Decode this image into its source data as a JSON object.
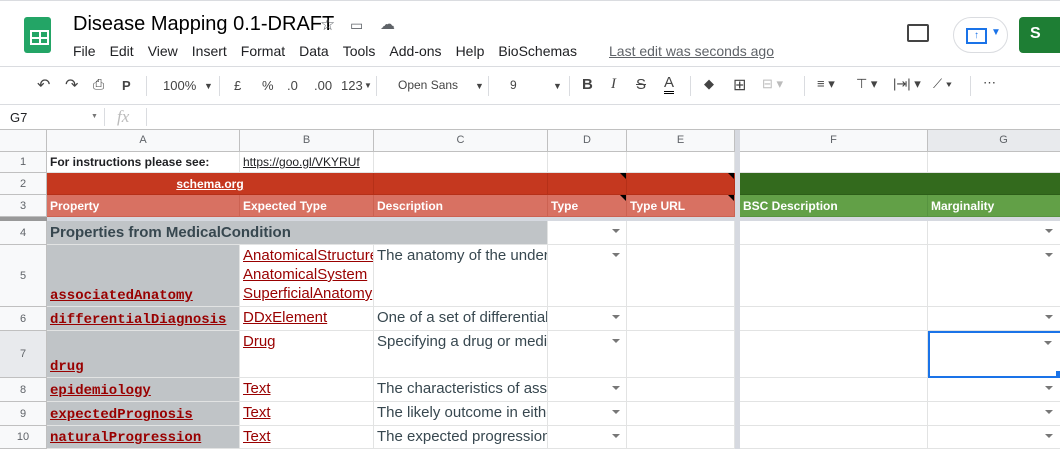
{
  "app": {
    "title": "Disease Mapping 0.1-DRAFT",
    "menu": [
      "File",
      "Edit",
      "View",
      "Insert",
      "Format",
      "Data",
      "Tools",
      "Add-ons",
      "Help",
      "BioSchemas"
    ],
    "last_edit": "Last edit was seconds ago",
    "share_label": "S"
  },
  "toolbar": {
    "zoom": "100%",
    "currency": "£",
    "percent": "%",
    "dec_less": ".0",
    "dec_more": ".00",
    "format": "123",
    "font": "Open Sans",
    "font_size": "9"
  },
  "formula": {
    "cell_ref": "G7",
    "fx": "fx",
    "value": ""
  },
  "columns": [
    "A",
    "B",
    "C",
    "D",
    "E",
    "F",
    "G"
  ],
  "rows": [
    {
      "num": "1",
      "a": "For instructions please see:",
      "b": "https://goo.gl/VKYRUf"
    },
    {
      "num": "2",
      "a": "schema.org"
    },
    {
      "num": "3",
      "headers": [
        "Property",
        "Expected Type",
        "Description",
        "Type",
        "Type URL",
        "BSC Description",
        "Marginality"
      ]
    },
    {
      "num": "4",
      "a": "Properties from MedicalCondition"
    },
    {
      "num": "5",
      "a": "associatedAnatomy",
      "b": "AnatomicalStructure\nAnatomicalSystem\nSuperficialAnatomy",
      "c": "The anatomy of the underlying"
    },
    {
      "num": "6",
      "a": "differentialDiagnosis",
      "b": "DDxElement",
      "c": "One of a set of differential"
    },
    {
      "num": "7",
      "a": "drug",
      "b": "Drug",
      "c": "Specifying a drug or medicine"
    },
    {
      "num": "8",
      "a": "epidemiology",
      "b": "Text",
      "c": "The characteristics of associated"
    },
    {
      "num": "9",
      "a": "expectedPrognosis",
      "b": "Text",
      "c": "The likely outcome in either"
    },
    {
      "num": "10",
      "a": "naturalProgression",
      "b": "Text",
      "c": "The expected progression"
    }
  ],
  "colors": {
    "schema_red": "#c5381f",
    "schema_red_light": "#d87162",
    "bsc_green": "#336a1d",
    "bsc_green_light": "#62a047",
    "section_gray": "#c0c4c7",
    "link_red": "#990000",
    "selection": "#1a73e8"
  }
}
